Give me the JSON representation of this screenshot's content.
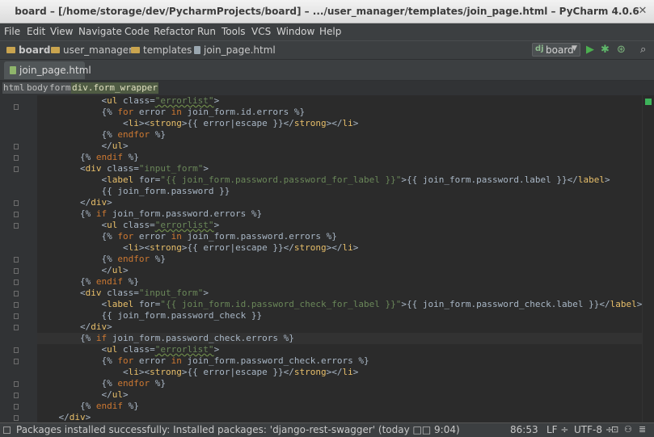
{
  "window": {
    "title": "board – [/home/storage/dev/PycharmProjects/board] – .../user_manager/templates/join_page.html – PyCharm 4.0.6"
  },
  "menu": [
    "File",
    "Edit",
    "View",
    "Navigate",
    "Code",
    "Refactor",
    "Run",
    "Tools",
    "VCS",
    "Window",
    "Help"
  ],
  "nav": {
    "crumbs": [
      "board",
      "user_manager",
      "templates",
      "join_page.html"
    ],
    "run_config": "board"
  },
  "tabs": [
    {
      "label": "join_page.html"
    }
  ],
  "breadcrumbs": [
    "html",
    "body",
    "form",
    "div.form_wrapper"
  ],
  "status": {
    "message": "Packages installed successfully: Installed packages: 'django-rest-swagger' (today □□ 9:04)",
    "position": "86:53",
    "line_sep": "LF ÷",
    "encoding": "UTF-8 ÷"
  },
  "colors": {
    "keyword": "#cc7832",
    "string": "#6a8759",
    "tag": "#e8bf6a",
    "text": "#a9b7c6",
    "background": "#2b2b2b"
  },
  "icons": [
    "folder-icon",
    "html-file-icon",
    "run-icon",
    "debug-icon",
    "coverage-icon",
    "search-icon",
    "close-icon",
    "lightbulb-icon"
  ],
  "code": [
    [
      [
        "",
        "            <"
      ],
      [
        "tg",
        "ul"
      ],
      [
        "",
        " class="
      ],
      [
        "str und",
        "\"errorlist\""
      ],
      [
        "",
        ">"
      ]
    ],
    [
      [
        "",
        "            {% "
      ],
      [
        "kw",
        "for"
      ],
      [
        "",
        " error "
      ],
      [
        "kw",
        "in"
      ],
      [
        "",
        " join_form.id.errors %}"
      ]
    ],
    [
      [
        "",
        "                <"
      ],
      [
        "tg",
        "li"
      ],
      [
        "",
        "><"
      ],
      [
        "tg",
        "strong"
      ],
      [
        "",
        ">{{ error|escape }}</"
      ],
      [
        "tg",
        "strong"
      ],
      [
        "",
        "></"
      ],
      [
        "tg",
        "li"
      ],
      [
        "",
        ">"
      ]
    ],
    [
      [
        "",
        "            {% "
      ],
      [
        "kw",
        "endfor"
      ],
      [
        "",
        " %}"
      ]
    ],
    [
      [
        "",
        "            </"
      ],
      [
        "tg",
        "ul"
      ],
      [
        "",
        ">"
      ]
    ],
    [
      [
        "",
        "        {% "
      ],
      [
        "kw",
        "endif"
      ],
      [
        "",
        " %}"
      ]
    ],
    [
      [
        "",
        "        <"
      ],
      [
        "tg",
        "div"
      ],
      [
        "",
        " class="
      ],
      [
        "str",
        "\"input_form\""
      ],
      [
        "",
        ">"
      ]
    ],
    [
      [
        "",
        "            <"
      ],
      [
        "tg",
        "label"
      ],
      [
        "",
        " for="
      ],
      [
        "str",
        "\"{{ join_form.password.password_for_label }}\""
      ],
      [
        "",
        ">{{ join_form.password.label }}</"
      ],
      [
        "tg",
        "label"
      ],
      [
        "",
        ">"
      ]
    ],
    [
      [
        "",
        "            {{ join_form.password }}"
      ]
    ],
    [
      [
        "",
        "        </"
      ],
      [
        "tg",
        "div"
      ],
      [
        "",
        ">"
      ]
    ],
    [
      [
        "",
        "        {% "
      ],
      [
        "kw",
        "if"
      ],
      [
        "",
        " join_form.password.errors %}"
      ]
    ],
    [
      [
        "",
        "            <"
      ],
      [
        "tg",
        "ul"
      ],
      [
        "",
        " class="
      ],
      [
        "str und",
        "\"errorlist\""
      ],
      [
        "",
        ">"
      ]
    ],
    [
      [
        "",
        "            {% "
      ],
      [
        "kw",
        "for"
      ],
      [
        "",
        " error "
      ],
      [
        "kw",
        "in"
      ],
      [
        "",
        " join_form.password.errors %}"
      ]
    ],
    [
      [
        "",
        "                <"
      ],
      [
        "tg",
        "li"
      ],
      [
        "",
        "><"
      ],
      [
        "tg",
        "strong"
      ],
      [
        "",
        ">{{ error|escape }}</"
      ],
      [
        "tg",
        "strong"
      ],
      [
        "",
        "></"
      ],
      [
        "tg",
        "li"
      ],
      [
        "",
        ">"
      ]
    ],
    [
      [
        "",
        "            {% "
      ],
      [
        "kw",
        "endfor"
      ],
      [
        "",
        " %}"
      ]
    ],
    [
      [
        "",
        "            </"
      ],
      [
        "tg",
        "ul"
      ],
      [
        "",
        ">"
      ]
    ],
    [
      [
        "",
        "        {% "
      ],
      [
        "kw",
        "endif"
      ],
      [
        "",
        " %}"
      ]
    ],
    [
      [
        "",
        "        <"
      ],
      [
        "tg",
        "div"
      ],
      [
        "",
        " class="
      ],
      [
        "str",
        "\"input_form\""
      ],
      [
        "",
        ">"
      ]
    ],
    [
      [
        "",
        "            <"
      ],
      [
        "tg",
        "label"
      ],
      [
        "",
        " for="
      ],
      [
        "str",
        "\"{{ join_form.id.password_check_for_label }}\""
      ],
      [
        "",
        ">{{ join_form.password_check.label }}</"
      ],
      [
        "tg",
        "label"
      ],
      [
        "",
        ">"
      ]
    ],
    [
      [
        "",
        "            {{ join_form.password_check }}"
      ]
    ],
    [
      [
        "",
        "        </"
      ],
      [
        "tg",
        "div"
      ],
      [
        "",
        ">"
      ]
    ],
    [
      [
        "",
        "        {% "
      ],
      [
        "kw",
        "if"
      ],
      [
        "",
        " join_form.password_check.errors %}"
      ]
    ],
    [
      [
        "",
        "            <"
      ],
      [
        "tg",
        "ul"
      ],
      [
        "",
        " class="
      ],
      [
        "str und",
        "\"errorlist\""
      ],
      [
        "",
        ">"
      ]
    ],
    [
      [
        "",
        "            {% "
      ],
      [
        "kw",
        "for"
      ],
      [
        "",
        " error "
      ],
      [
        "kw",
        "in"
      ],
      [
        "",
        " join_form.password_check.errors %}"
      ]
    ],
    [
      [
        "",
        "                <"
      ],
      [
        "tg",
        "li"
      ],
      [
        "",
        "><"
      ],
      [
        "tg",
        "strong"
      ],
      [
        "",
        ">{{ error|escape }}</"
      ],
      [
        "tg",
        "strong"
      ],
      [
        "",
        "></"
      ],
      [
        "tg",
        "li"
      ],
      [
        "",
        ">"
      ]
    ],
    [
      [
        "",
        "            {% "
      ],
      [
        "kw",
        "endfor"
      ],
      [
        "",
        " %}"
      ]
    ],
    [
      [
        "",
        "            </"
      ],
      [
        "tg",
        "ul"
      ],
      [
        "",
        ">"
      ]
    ],
    [
      [
        "",
        "        {% "
      ],
      [
        "kw",
        "endif"
      ],
      [
        "",
        " %}"
      ]
    ],
    [
      [
        "",
        "    </"
      ],
      [
        "tg",
        "div"
      ],
      [
        "",
        ">"
      ]
    ]
  ],
  "current_line": 21
}
